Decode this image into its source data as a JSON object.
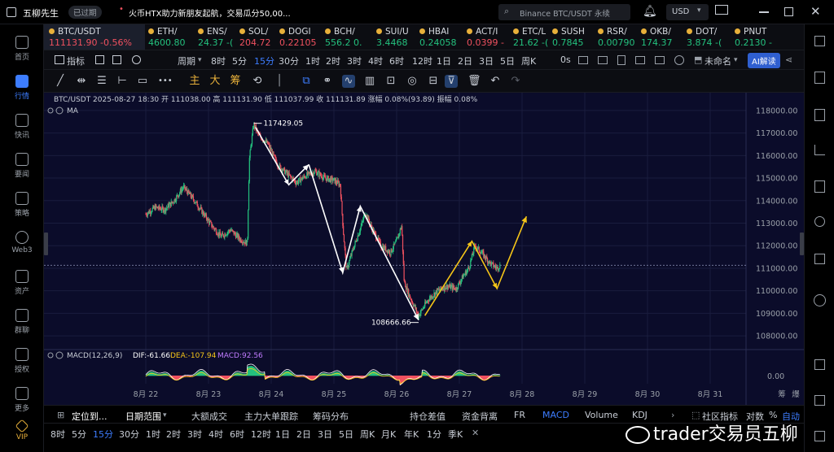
{
  "app": {
    "name": "五柳先生",
    "status_badge": "已过期"
  },
  "news": {
    "text": "火币HTX助力新朋友起航，交易瓜分50,00..."
  },
  "search": {
    "placeholder": "Binance BTC/USDT 永续"
  },
  "currency": {
    "selected": "USD"
  },
  "left_nav": [
    {
      "label": "首页",
      "icon": "home-icon"
    },
    {
      "label": "行情",
      "icon": "chart-bar-icon",
      "active": true
    },
    {
      "label": "快讯",
      "icon": "news-icon"
    },
    {
      "label": "要闻",
      "icon": "article-icon"
    },
    {
      "label": "策略",
      "icon": "strategy-icon"
    },
    {
      "label": "Web3",
      "icon": "web3-icon"
    },
    {
      "label": "资产",
      "icon": "wallet-icon"
    },
    {
      "label": "群聊",
      "icon": "chat-icon"
    },
    {
      "label": "授权",
      "icon": "key-icon"
    },
    {
      "label": "更多",
      "icon": "more-icon"
    },
    {
      "label": "VIP",
      "icon": "vip-icon"
    }
  ],
  "ticker": [
    {
      "symbol": "BTC/USDT",
      "price": "111131.90",
      "change": "-0.56%",
      "dir": "down"
    },
    {
      "symbol": "ETH/",
      "price": "4600.80",
      "change": "",
      "dir": "up"
    },
    {
      "symbol": "ENS/",
      "price": "24.37",
      "change": "-(",
      "dir": "up"
    },
    {
      "symbol": "SOL/",
      "price": "204.72",
      "change": "",
      "dir": "down"
    },
    {
      "symbol": "DOGI",
      "price": "0.22105",
      "change": "",
      "dir": "down"
    },
    {
      "symbol": "BCH/",
      "price": "556.2",
      "change": "0.",
      "dir": "up"
    },
    {
      "symbol": "SUI/U",
      "price": "3.4468",
      "change": "",
      "dir": "up"
    },
    {
      "symbol": "HBAI",
      "price": "0.24058",
      "change": "",
      "dir": "up"
    },
    {
      "symbol": "ACT/I",
      "price": "0.0399",
      "change": "-",
      "dir": "down"
    },
    {
      "symbol": "ETC/L",
      "price": "21.62",
      "change": "-(",
      "dir": "up"
    },
    {
      "symbol": "SUSH",
      "price": "0.7845",
      "change": "",
      "dir": "up"
    },
    {
      "symbol": "RSR/",
      "price": "0.00790",
      "change": "",
      "dir": "up"
    },
    {
      "symbol": "OKB/",
      "price": "174.37",
      "change": "",
      "dir": "up"
    },
    {
      "symbol": "DOT/",
      "price": "3.874",
      "change": "-(",
      "dir": "up"
    },
    {
      "symbol": "PNUT",
      "price": "0.2130",
      "change": "-",
      "dir": "up"
    }
  ],
  "toolbar": {
    "indicators": "指标",
    "periods": [
      "周期",
      "8时",
      "5分",
      "15分",
      "30分",
      "1时",
      "2时",
      "3时",
      "4时",
      "6时",
      "12时",
      "1日",
      "2日",
      "3日",
      "5日",
      "周K"
    ],
    "selected_period": "15分",
    "countdown": "0s",
    "layout_name": "未命名",
    "ai_button": "AI解读"
  },
  "drawing_tools": {
    "main": "主",
    "big": "大",
    "chips": "筹"
  },
  "chart_info": {
    "symbol_line": "BTC/USDT  2025-08-27 18:30  开 111038.00  高 111131.90  低 111037.99  收 111131.89  涨幅 0.08%(93.89)  振幅 0.08%",
    "ma_label": "MA",
    "macd_label": "MACD(12,26,9)",
    "dif": "DIF:-61.66",
    "dea": "DEA:-107.94",
    "macd": "MACD:92.56",
    "macd_zero": "0.00",
    "high_label": "117429.05",
    "low_label": "108666.66",
    "current_price": "111131.90"
  },
  "chart_data": {
    "type": "candlestick",
    "y_ticks": [
      118000,
      117000,
      116000,
      115000,
      114000,
      113000,
      112000,
      111000,
      110000,
      109000,
      108000
    ],
    "y_tick_labels": [
      "118000.00",
      "117000.00",
      "116000.00",
      "115000.00",
      "114000.00",
      "113000.00",
      "112000.00",
      "111000.00",
      "110000.00",
      "109000.00",
      "108000.00"
    ],
    "x_labels": [
      "8月 22",
      "8月 23",
      "8月 24",
      "8月 25",
      "8月 26",
      "8月 27",
      "8月 28",
      "8月 29",
      "8月 30",
      "8月 31"
    ],
    "x_extra": [
      "筹",
      "爆"
    ],
    "price_path": [
      [
        0,
        113400
      ],
      [
        0.15,
        113700
      ],
      [
        0.3,
        113600
      ],
      [
        0.45,
        114000
      ],
      [
        0.6,
        114600
      ],
      [
        0.75,
        114100
      ],
      [
        0.9,
        113500
      ],
      [
        1.05,
        112900
      ],
      [
        1.2,
        112400
      ],
      [
        1.35,
        112700
      ],
      [
        1.5,
        112300
      ],
      [
        1.62,
        112100
      ],
      [
        1.65,
        115800
      ],
      [
        1.72,
        117400
      ],
      [
        1.8,
        116900
      ],
      [
        1.95,
        116500
      ],
      [
        2.1,
        115600
      ],
      [
        2.25,
        115200
      ],
      [
        2.4,
        114800
      ],
      [
        2.55,
        115100
      ],
      [
        2.7,
        115300
      ],
      [
        2.85,
        115000
      ],
      [
        3.0,
        114900
      ],
      [
        3.1,
        114700
      ],
      [
        3.15,
        112600
      ],
      [
        3.2,
        110900
      ],
      [
        3.3,
        111800
      ],
      [
        3.45,
        113000
      ],
      [
        3.5,
        113500
      ],
      [
        3.6,
        112800
      ],
      [
        3.75,
        112000
      ],
      [
        3.9,
        111700
      ],
      [
        4.0,
        112200
      ],
      [
        4.08,
        112900
      ],
      [
        4.12,
        110400
      ],
      [
        4.2,
        109800
      ],
      [
        4.35,
        108900
      ],
      [
        4.5,
        109600
      ],
      [
        4.65,
        110000
      ],
      [
        4.8,
        110200
      ],
      [
        4.95,
        110100
      ],
      [
        5.05,
        110600
      ],
      [
        5.15,
        111000
      ],
      [
        5.25,
        112000
      ],
      [
        5.35,
        111700
      ],
      [
        5.5,
        111200
      ],
      [
        5.6,
        111000
      ],
      [
        5.65,
        111131.9
      ]
    ],
    "annotations": [
      {
        "color": "white",
        "points": [
          [
            1.75,
            117250
          ],
          [
            2.28,
            114700
          ],
          [
            2.6,
            115600
          ]
        ]
      },
      {
        "color": "white",
        "points": [
          [
            2.6,
            115600
          ],
          [
            3.14,
            110800
          ],
          [
            3.42,
            113750
          ],
          [
            4.35,
            108700
          ]
        ]
      },
      {
        "color": "yellow",
        "points": [
          [
            4.45,
            108900
          ],
          [
            5.2,
            112200
          ],
          [
            5.6,
            110100
          ],
          [
            6.07,
            113300
          ]
        ]
      }
    ],
    "macd_series": "oscillating",
    "ylim": [
      107500,
      118500
    ]
  },
  "bottom": {
    "tabs": [
      "定位到...",
      "日期范围",
      "大额成交",
      "主力大单跟踪",
      "筹码分布",
      "持仓差值",
      "资金背离",
      "FR",
      "MACD",
      "Volume",
      "KDJ"
    ],
    "active_tab": "MACD",
    "right_items": [
      "社区指标",
      "对数",
      "%",
      "自动"
    ],
    "periods": [
      "8时",
      "5分",
      "15分",
      "30分",
      "1时",
      "2时",
      "3时",
      "4时",
      "6时",
      "12时",
      "1日",
      "2日",
      "3日",
      "5日",
      "周K",
      "月K",
      "年K",
      "1分",
      "季K"
    ],
    "selected_period": "15分"
  },
  "watermark": "trader交易员五柳"
}
